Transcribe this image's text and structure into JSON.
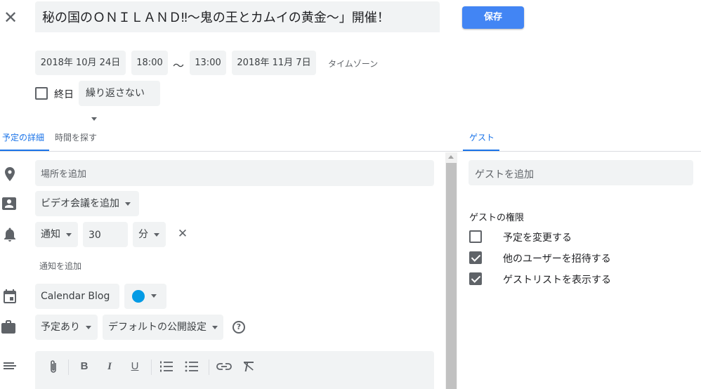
{
  "event": {
    "title": "秘の国のＯＮＩＬＡＮＤ‼〜鬼の王とカムイの黄金〜」開催！",
    "save_label": "保存",
    "start_date": "2018年 10月 24日",
    "start_time": "18:00",
    "separator": "〜",
    "end_time": "13:00",
    "end_date": "2018年 11月 7日",
    "timezone_label": "タイムゾーン",
    "all_day_label": "終日",
    "repeat_label": "繰り返さない"
  },
  "tabs": {
    "details": "予定の詳細",
    "find_time": "時間を探す",
    "guests": "ゲスト"
  },
  "details": {
    "location_placeholder": "場所を追加",
    "video_label": "ビデオ会議を追加",
    "notification_type": "通知",
    "notification_value": "30",
    "notification_unit": "分",
    "add_notification": "通知を追加",
    "calendar_name": "Calendar Blog",
    "calendar_color": "#039be5",
    "availability": "予定あり",
    "visibility": "デフォルトの公開設定",
    "help_icon_text": "?"
  },
  "guests": {
    "add_placeholder": "ゲストを追加",
    "permissions_title": "ゲストの権限",
    "permissions": [
      {
        "label": "予定を変更する",
        "checked": false
      },
      {
        "label": "他のユーザーを招待する",
        "checked": true
      },
      {
        "label": "ゲストリストを表示する",
        "checked": true
      }
    ]
  },
  "toolbar": {
    "icons": [
      "attach-icon",
      "bold-icon",
      "italic-icon",
      "underline-icon",
      "numbered-list-icon",
      "bulleted-list-icon",
      "link-icon",
      "clear-format-icon"
    ]
  },
  "colors": {
    "accent": "#1a73e8",
    "save_button": "#4285f4",
    "field_bg": "#f1f3f4"
  }
}
